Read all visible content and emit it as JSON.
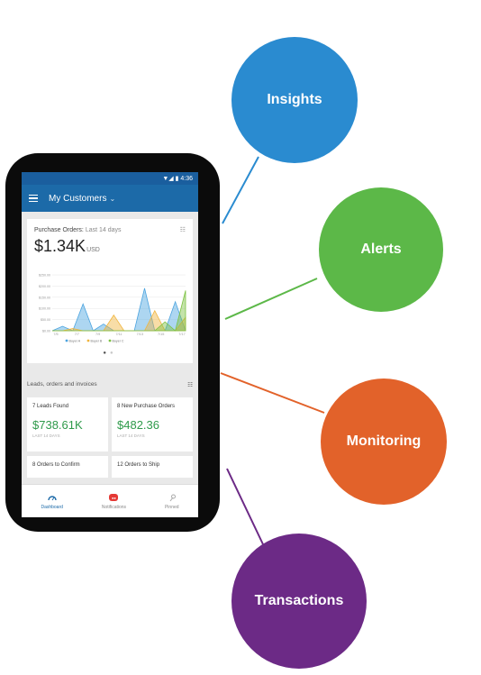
{
  "colors": {
    "insights": "#2a8bd0",
    "alerts": "#5cb848",
    "monitoring": "#e2622a",
    "transactions": "#6c2a86",
    "app_blue": "#1c6aa8",
    "value_green": "#2e9a4a"
  },
  "features": [
    {
      "label": "Insights"
    },
    {
      "label": "Alerts"
    },
    {
      "label": "Monitoring"
    },
    {
      "label": "Transactions"
    }
  ],
  "phone": {
    "status": {
      "time": "4:36",
      "icons": "signal-wifi-battery"
    },
    "header": {
      "title": "My Customers",
      "menu_icon": "hamburger-icon",
      "dropdown_icon": "chevron-down-icon"
    },
    "purchase_orders": {
      "title": "Purchase Orders:",
      "range": "Last 14 days",
      "amount": "$1.34K",
      "currency": "USD",
      "filter_icon": "filter-icon"
    },
    "section_label": "Leads, orders and invoices",
    "tiles": [
      {
        "title": "7 Leads Found",
        "value": "$738.61K",
        "sub": "LAST 14 DAYS"
      },
      {
        "title": "8 New Purchase Orders",
        "value": "$482.36",
        "sub": "LAST 14 DAYS"
      },
      {
        "title": "8 Orders to Confirm"
      },
      {
        "title": "12 Orders to Ship"
      }
    ],
    "nav": [
      {
        "label": "Dashboard",
        "icon": "gauge-icon"
      },
      {
        "label": "Notifications",
        "icon": "bell-icon"
      },
      {
        "label": "Pinned",
        "icon": "pin-icon"
      }
    ]
  },
  "chart_data": {
    "type": "area",
    "categories": [
      "7/5",
      "7/7",
      "7/9",
      "7/11",
      "7/13",
      "7/15",
      "7/17"
    ],
    "ylim": [
      0,
      250
    ],
    "y_ticks": [
      "$0.00",
      "$50.00",
      "$100.00",
      "$150.00",
      "$200.00",
      "$250.00"
    ],
    "series": [
      {
        "name": "Buyer A",
        "color": "#4aa3df",
        "values": [
          0,
          20,
          0,
          120,
          0,
          30,
          0,
          0,
          0,
          190,
          0,
          0,
          130,
          0
        ]
      },
      {
        "name": "Buyer B",
        "color": "#f0b43c",
        "values": [
          0,
          0,
          10,
          0,
          0,
          0,
          70,
          0,
          0,
          0,
          90,
          0,
          0,
          60
        ]
      },
      {
        "name": "Buyer C",
        "color": "#7cc242",
        "values": [
          0,
          0,
          0,
          0,
          0,
          0,
          0,
          0,
          0,
          0,
          0,
          40,
          0,
          180
        ]
      }
    ]
  }
}
